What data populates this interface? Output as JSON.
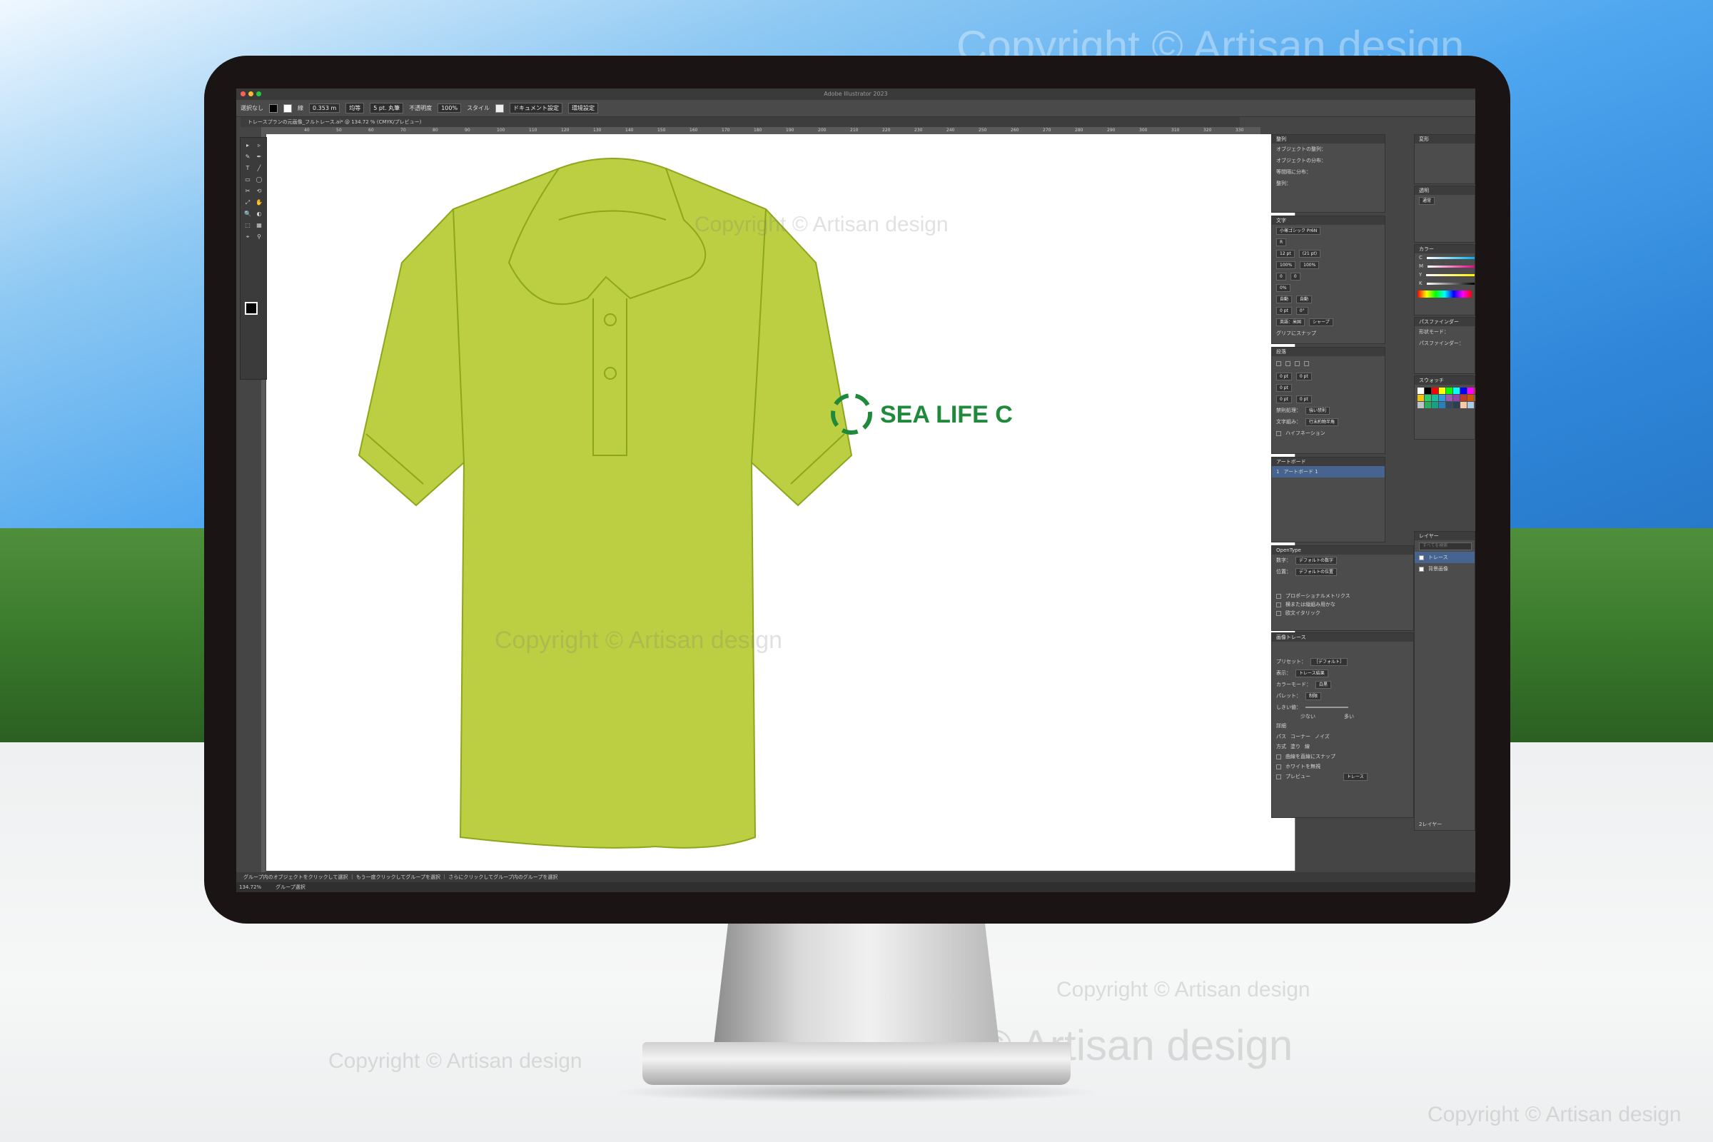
{
  "watermark": "Copyright © Artisan design",
  "app": {
    "window_title": "Adobe Illustrator 2023",
    "document_tab": "トレースプランの元画像_フルトレース.ai* @ 134.72 % (CMYK/プレビュー)"
  },
  "control_bar": {
    "selection": "選択なし",
    "stroke_label": "線",
    "stroke_width": "0.353 m",
    "line_style": "均等",
    "brush": "5 pt. 丸筆",
    "opacity_label": "不透明度",
    "opacity": "100%",
    "style_label": "スタイル",
    "document_setup": "ドキュメント設定",
    "preferences": "環境設定"
  },
  "ruler": [
    "40",
    "50",
    "60",
    "70",
    "80",
    "90",
    "100",
    "110",
    "120",
    "130",
    "140",
    "150",
    "160",
    "170",
    "180",
    "190",
    "200",
    "210",
    "220",
    "230",
    "240",
    "250",
    "260",
    "270",
    "280",
    "290",
    "300",
    "310",
    "320",
    "330"
  ],
  "artwork": {
    "logo_text": "SEA LIFE C",
    "shirt_color": "#bccf42",
    "shirt_stroke": "#8da61c",
    "logo_color": "#1f8a3b"
  },
  "panels": {
    "align": {
      "title": "整列",
      "align_objects": "オブジェクトの整列：",
      "distribute_objects": "オブジェクトの分布：",
      "distribute_spacing": "等間隔に分布：",
      "align_to": "整列："
    },
    "character": {
      "title": "文字",
      "font": "小塚ゴシック Pr6N",
      "style": "R",
      "size": "12 pt",
      "leading": "(21 pt)",
      "scale_v": "100%",
      "scale_h": "100%",
      "kerning": "0",
      "tracking": "0",
      "tsume": "0%",
      "auto1": "自動",
      "auto2": "自動",
      "baseline": "0 pt",
      "rotation": "0°",
      "language": "英語：米国",
      "antialias": "シャープ",
      "glyph_snap": "グリフにスナップ"
    },
    "paragraph": {
      "title": "段落",
      "indent_left": "0 pt",
      "indent_right": "0 pt",
      "indent_first": "0 pt",
      "space_before": "0 pt",
      "space_after": "0 pt",
      "kinsoku_label": "禁則処理：",
      "kinsoku": "強い禁則",
      "mojikumi_label": "文字組み：",
      "mojikumi": "行末約物半角",
      "hyphenation": "ハイフネーション"
    },
    "artboards": {
      "title": "アートボード",
      "index": "1",
      "name": "アートボード 1"
    },
    "opentype": {
      "title": "OpenType",
      "figure_label": "数字：",
      "figure": "デフォルトの数字",
      "position_label": "位置：",
      "position": "デフォルトの位置",
      "opt1": "プロポーショナルメトリクス",
      "opt2": "横または縦組み用かな",
      "opt3": "欧文イタリック"
    },
    "image_trace": {
      "title": "画像トレース",
      "preset_label": "プリセット：",
      "preset": "［デフォルト］",
      "view_label": "表示：",
      "view": "トレース結果",
      "mode_label": "カラーモード：",
      "mode": "白黒",
      "palette_label": "パレット：",
      "palette": "制限",
      "threshold_label": "しきい値：",
      "low": "少ない",
      "high": "多い",
      "advanced": "詳細",
      "paths": "パス",
      "corners": "コーナー",
      "noise": "ノイズ",
      "method_label": "方式",
      "fill_label": "塗り",
      "stroke_label": "線",
      "snap_curves": "曲線を直線にスナップ",
      "ignore_white": "ホワイトを無視",
      "preview": "プレビュー",
      "trace": "トレース"
    },
    "properties": {
      "title": "変形"
    },
    "appearance": {
      "title": "透明",
      "blend": "通常"
    },
    "color": {
      "title": "カラー",
      "c": "C",
      "m": "M",
      "y": "Y",
      "k": "K"
    },
    "pathfinder": {
      "title": "パスファインダー",
      "shape_modes": "形状モード：",
      "pathfinder_label": "パスファインダー："
    },
    "swatches": {
      "title": "スウォッチ",
      "colors": [
        "#ffffff",
        "#000000",
        "#ff0000",
        "#ffff00",
        "#00ff00",
        "#00ffff",
        "#0000ff",
        "#ff00ff",
        "#e63b2e",
        "#f39c12",
        "#f1c40f",
        "#2ecc71",
        "#1abc9c",
        "#3498db",
        "#9b59b6",
        "#8e44ad",
        "#c0392b",
        "#d35400",
        "#7f8c8d",
        "#95a5a6",
        "#bdc3c7",
        "#27ae60",
        "#16a085",
        "#2980b9",
        "#34495e",
        "#2c3e50",
        "#f5cba7",
        "#a9cce3",
        "#6d4c41",
        "#c5e1a5"
      ]
    },
    "layers": {
      "title": "レイヤー",
      "search_placeholder": "すべてを検索",
      "layer1": "トレース",
      "layer2": "背景画像",
      "footer": "2レイヤー"
    }
  },
  "status": {
    "hint": "グループ内のオブジェクトをクリックして選択 ｜ もう一度クリックしてグループを選択 ｜ さらにクリックしてグループ内のグループを選択",
    "zoom": "134.72%",
    "tool": "グループ選択"
  }
}
